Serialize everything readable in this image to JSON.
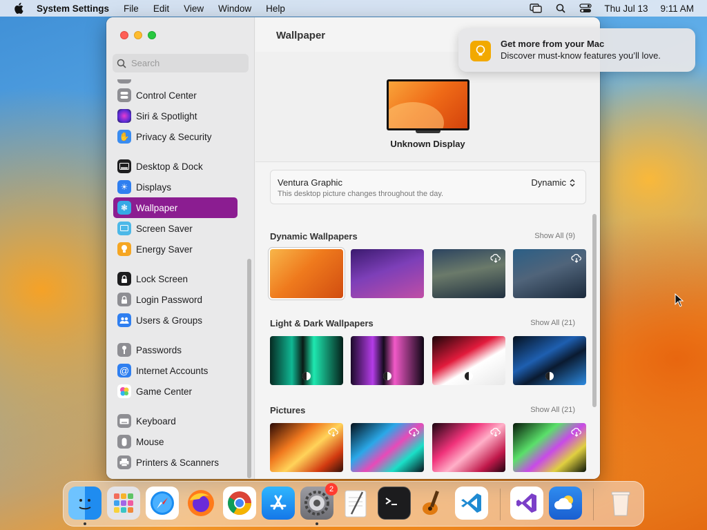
{
  "menubar": {
    "app_name": "System Settings",
    "items": [
      "File",
      "Edit",
      "View",
      "Window",
      "Help"
    ],
    "date": "Thu Jul 13",
    "time": "9:11 AM"
  },
  "window": {
    "search_placeholder": "Search",
    "sidebar": {
      "items": [
        {
          "label": "Control Center",
          "icon": "control-center-icon",
          "color": "#8e8e93"
        },
        {
          "label": "Siri & Spotlight",
          "icon": "siri-icon",
          "color": "#7b3ee0"
        },
        {
          "label": "Privacy & Security",
          "icon": "hand-icon",
          "color": "#3a8cf0"
        },
        {
          "label": "Desktop & Dock",
          "icon": "dock-icon",
          "color": "#1d1d1f"
        },
        {
          "label": "Displays",
          "icon": "sun-icon",
          "color": "#2f7ff0"
        },
        {
          "label": "Wallpaper",
          "icon": "flower-icon",
          "color": "#35a9e6",
          "active": true
        },
        {
          "label": "Screen Saver",
          "icon": "screen-saver-icon",
          "color": "#4cb8e8"
        },
        {
          "label": "Energy Saver",
          "icon": "bulb-icon",
          "color": "#f5a623"
        },
        {
          "label": "Lock Screen",
          "icon": "lock-icon",
          "color": "#1d1d1f"
        },
        {
          "label": "Login Password",
          "icon": "lock-icon",
          "color": "#8e8e93"
        },
        {
          "label": "Users & Groups",
          "icon": "users-icon",
          "color": "#2f7ff0"
        },
        {
          "label": "Passwords",
          "icon": "key-icon",
          "color": "#8e8e93"
        },
        {
          "label": "Internet Accounts",
          "icon": "at-icon",
          "color": "#2f7ff0"
        },
        {
          "label": "Game Center",
          "icon": "game-center-icon",
          "color": "#ffffff"
        },
        {
          "label": "Keyboard",
          "icon": "keyboard-icon",
          "color": "#8e8e93"
        },
        {
          "label": "Mouse",
          "icon": "mouse-icon",
          "color": "#8e8e93"
        },
        {
          "label": "Printers & Scanners",
          "icon": "printer-icon",
          "color": "#8e8e93"
        }
      ]
    },
    "main": {
      "title": "Wallpaper",
      "display_name": "Unknown Display",
      "current": {
        "name": "Ventura Graphic",
        "description": "This desktop picture changes throughout the day.",
        "mode": "Dynamic"
      },
      "sections": [
        {
          "title": "Dynamic Wallpapers",
          "show_all": "Show All (9)"
        },
        {
          "title": "Light & Dark Wallpapers",
          "show_all": "Show All (21)"
        },
        {
          "title": "Pictures",
          "show_all": "Show All (21)"
        }
      ]
    }
  },
  "notification": {
    "title": "Get more from your Mac",
    "body": "Discover must-know features you’ll love."
  },
  "dock": {
    "apps": [
      "finder-icon",
      "launchpad-icon",
      "safari-icon",
      "firefox-icon",
      "chrome-icon",
      "app-store-icon",
      "system-settings-icon",
      "textedit-icon",
      "terminal-icon",
      "garageband-icon",
      "vscode-icon",
      "visual-studio-icon",
      "weather-icon",
      "trash-icon"
    ],
    "settings_badge": "2"
  }
}
